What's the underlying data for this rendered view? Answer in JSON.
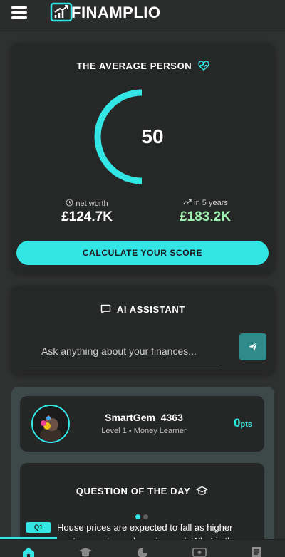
{
  "header": {
    "brand": "FINAMPLIO",
    "menu_icon": "hamburger-menu-icon",
    "logo_icon": "logo-chart-arrow-icon"
  },
  "average_card": {
    "title": "THE AVERAGE PERSON",
    "title_icon": "heart-pulse-icon",
    "score": "50",
    "score_fraction": 0.5,
    "net_worth_label": "net worth",
    "net_worth_value": "£124.7K",
    "future_label": "in 5 years",
    "future_value": "£183.2K",
    "cta_label": "CALCULATE YOUR SCORE"
  },
  "ai_assistant": {
    "title": "AI ASSISTANT",
    "title_icon": "chat-bubble-icon",
    "placeholder": "Ask anything about your finances...",
    "send_icon": "send-icon"
  },
  "profile": {
    "username": "SmartGem_4363",
    "level": "Level 1 • Money Learner",
    "points": "0",
    "points_unit": "pts"
  },
  "question_of_day": {
    "title": "QUESTION OF THE DAY",
    "title_icon": "graduation-cap-icon",
    "badge": "Q1",
    "text": "House prices are expected to fall as higher mortgage rates reduce demand. What is the",
    "active_dot": 0
  },
  "bottom_nav": {
    "items": [
      "home-icon",
      "learn-icon",
      "pie-chart-icon",
      "money-icon",
      "news-icon"
    ],
    "active": 0
  },
  "colors": {
    "accent": "#33e6e6",
    "future_value": "#9ff0b0",
    "background": "#2f3030",
    "card": "#262727"
  }
}
